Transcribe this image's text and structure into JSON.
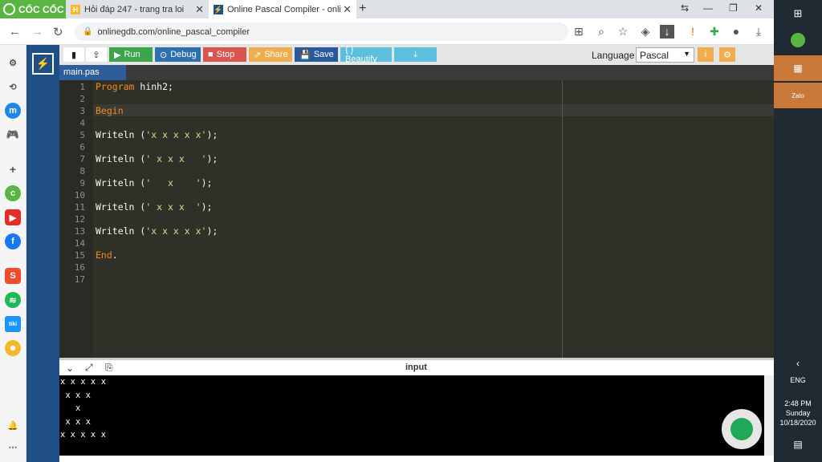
{
  "browser": {
    "brand": "CỐC CỐC",
    "tabs": [
      {
        "title": "Hỏi đáp 247 - trang tra loi",
        "icon": "hoidap-icon"
      },
      {
        "title": "Online Pascal Compiler - onli",
        "icon": "gdb-icon"
      }
    ],
    "url": "onlinegdb.com/online_pascal_compiler"
  },
  "toolbar": {
    "run": "Run",
    "debug": "Debug",
    "stop": "Stop",
    "share": "Share",
    "save": "Save",
    "beautify": "{ } Beautify",
    "language_label": "Language",
    "language_value": "Pascal"
  },
  "file_tab": "main.pas",
  "editor": {
    "lines": [
      {
        "n": "1",
        "kw": "Program",
        "rest": " hinh2",
        "end": ";"
      },
      {
        "n": "2",
        "kw": "",
        "rest": "",
        "end": ""
      },
      {
        "n": "3",
        "kw": "Begin",
        "rest": "",
        "end": ""
      },
      {
        "n": "4",
        "kw": "",
        "rest": "",
        "end": ""
      },
      {
        "n": "5",
        "fn": "Writeln (",
        "str": "'x x x x x'",
        "end": ");"
      },
      {
        "n": "6"
      },
      {
        "n": "7",
        "fn": "Writeln (",
        "str": "' x x x   '",
        "end": ");"
      },
      {
        "n": "8"
      },
      {
        "n": "9",
        "fn": "Writeln (",
        "str": "'   x    '",
        "end": ");"
      },
      {
        "n": "10"
      },
      {
        "n": "11",
        "fn": "Writeln (",
        "str": "' x x x  '",
        "end": ");"
      },
      {
        "n": "12"
      },
      {
        "n": "13",
        "fn": "Writeln (",
        "str": "'x x x x x'",
        "end": ");"
      },
      {
        "n": "14"
      },
      {
        "n": "15",
        "kw": "End",
        "end": "."
      },
      {
        "n": "16"
      },
      {
        "n": "17"
      }
    ]
  },
  "terminal": {
    "title": "input",
    "output": [
      "x x x x x",
      " x x x",
      "   x",
      " x x x",
      "x x x x x"
    ]
  },
  "taskbar": {
    "lang": "ENG",
    "time": "2:48 PM",
    "day": "Sunday",
    "date": "10/18/2020"
  },
  "colors": {
    "gdb_blue": "#1f4f85",
    "run_green": "#3aa54a",
    "debug_blue": "#2e6fb0",
    "stop_red": "#d9534f",
    "share_orange": "#f0ad4e",
    "save_blue": "#27599e",
    "beautify_teal": "#5bc0de"
  }
}
